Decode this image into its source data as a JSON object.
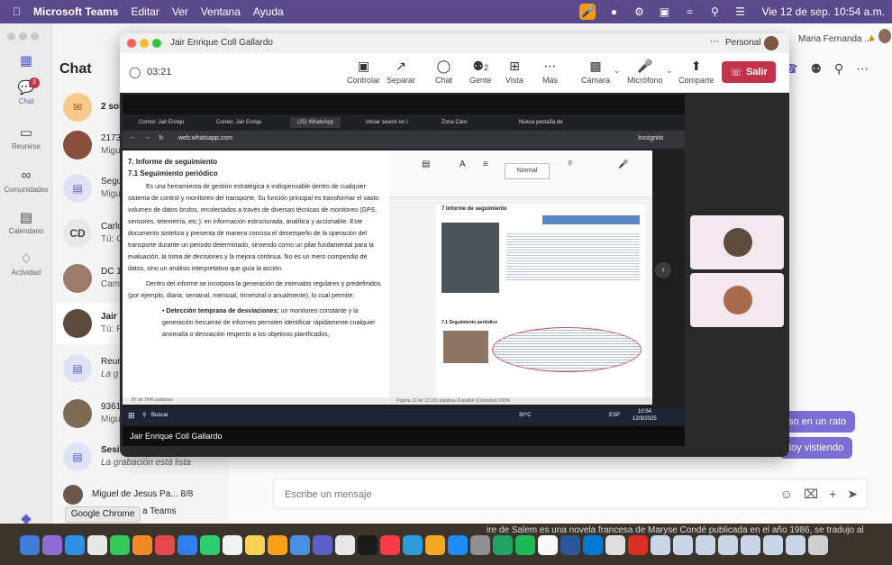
{
  "menubar": {
    "app_name": "Microsoft Teams",
    "menus": [
      "Editar",
      "Ver",
      "Ventana",
      "Ayuda"
    ],
    "datetime": "Vie 12 de sep.  10:54 a.m."
  },
  "rail": {
    "items": [
      {
        "label": "Chat",
        "icon": "chat-icon"
      },
      {
        "label": "Reunirse",
        "icon": "video-icon"
      },
      {
        "label": "Comunidades",
        "icon": "communities-icon"
      },
      {
        "label": "Calendario",
        "icon": "calendar-icon"
      },
      {
        "label": "Actividad",
        "icon": "bell-icon"
      }
    ],
    "chat_badge": "3"
  },
  "chatlist": {
    "title": "Chat",
    "rows": [
      {
        "line1": "2 sol",
        "line2": ""
      },
      {
        "line1": "2173",
        "line2": "Migu"
      },
      {
        "line1": "Segu",
        "line2": "Migu"
      },
      {
        "line1": "Carlo",
        "line2": "Tú: C",
        "initials": "CD"
      },
      {
        "line1": "DC 1",
        "line2": "Cam"
      },
      {
        "line1": "Jair I",
        "line2": "Tú: R"
      },
      {
        "line1": "Reur",
        "line2": "La g"
      },
      {
        "line1": "9361",
        "line2": "Migu"
      },
      {
        "line1": "Sesión Informativa ... 12/8",
        "line2": "La grabación está lista"
      },
      {
        "line1": "Miguel de Jesus Pa...  8/8",
        "line2": ""
      }
    ],
    "footer_text": "a Teams"
  },
  "chatmain": {
    "header_name": "Maria Fernanda ...",
    "bubbles": [
      "so en un rato",
      "toy vistiendo"
    ],
    "compose_placeholder": "Escribe un mensaje"
  },
  "meeting": {
    "window_title": "Jair Enrique Coll Gallardo",
    "personal_label": "Personal",
    "timer": "03:21",
    "toolbar": [
      {
        "label": "Controlar",
        "icon": "control-icon"
      },
      {
        "label": "Separar",
        "icon": "popout-icon"
      },
      {
        "label": "Chat",
        "icon": "chat-icon"
      },
      {
        "label": "Gente",
        "icon": "people-icon",
        "count": "2"
      },
      {
        "label": "Vista",
        "icon": "grid-icon"
      },
      {
        "label": "Más",
        "icon": "more-icon"
      },
      {
        "label": "Cámara",
        "icon": "camera-off-icon"
      },
      {
        "label": "Micrófono",
        "icon": "mic-icon"
      },
      {
        "label": "Comparte",
        "icon": "share-icon"
      }
    ],
    "leave_label": "Salir",
    "presenter_name": "Jair Enrique Coll Gallardo"
  },
  "shared_screen": {
    "tabs": [
      "Correo: Jair Enriqu",
      "Correo: Jair Enriqu",
      "(25) WhatsApp",
      "Iniciar sesión en t",
      "Zona Caro",
      "Nueva pestaña de"
    ],
    "url": "web.whatsapp.com",
    "incognito": "Incógnito",
    "doc_heading": "7.  Informe de seguimiento",
    "doc_subheading": "7.1 Seguimiento periódico",
    "doc_paragraphs": [
      "Es una herramienta de gestión estratégica e indispensable dentro de cualquier sistema de control y monitoreo del transporte. Su función principal es transformar el vasto volumen de datos brutos, recolectados a través de diversas técnicas de monitoreo (GPS, sensores, telemetría, etc.), en información estructurada, analítica y accionable. Este documento sintetiza y presenta de manera concisa el desempeño de la operación del transporte durante un periodo determinado, sirviendo como un pilar fundamental para la evaluación, la toma de decisiones y la mejora continua. No es un mero compendio de datos, sino un análisis interpretativo que guía la acción.",
      "Dentro del informe se incorpora la generación de intervalos regulares y predefinidos (por ejemplo, diaria, semanal, mensual, trimestral o anualmente), lo cual permite:"
    ],
    "doc_bullet_bold": "Detección temprana de desviaciones:",
    "doc_bullet_text": " un monitoreo constante y la generación frecuente de informes permiten identificar rápidamente cualquier anomalía o desviación respecto a los objetivos planificados,",
    "doc_status": "87 de 7846 palabras",
    "word_style": "Normal",
    "word_page_heading": "7  Informe de seguimiento",
    "word_page_sub": "7.1 Seguimiento periódico",
    "word_status": "Página 13 de 13   191 palabras   Español (Colombia)   100%",
    "taskbar_search": "Buscar",
    "taskbar_temp": "30°C",
    "taskbar_lang": "ESP",
    "taskbar_time": "10:54",
    "taskbar_date": "12/9/2025"
  },
  "tooltip": "Google Chrome",
  "dock_text": "ire de Salem es una novela francesa de Maryse Condé publicada en el año 1986, se tradujo al"
}
